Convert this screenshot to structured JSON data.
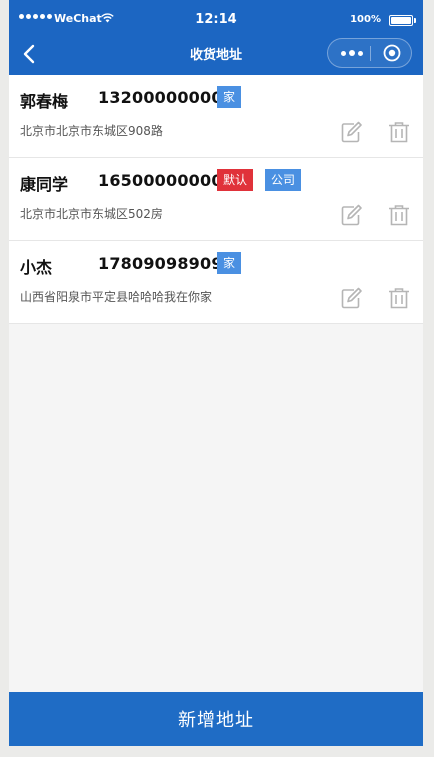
{
  "status_bar": {
    "carrier": "WeChat",
    "time": "12:14",
    "battery": "100%",
    "battery_level": 1.0,
    "signal_bars": 5
  },
  "nav": {
    "title": "收货地址",
    "back_icon": "chevron-left-icon",
    "more_icon": "more-dots-icon",
    "home_icon": "target-circle-icon"
  },
  "addresses": [
    {
      "name": "郭春梅",
      "phone": "13200000000",
      "tags": [
        {
          "label": "家",
          "kind": "home"
        }
      ],
      "address": "北京市北京市东城区908路"
    },
    {
      "name": "康同学",
      "phone": "16500000000",
      "tags": [
        {
          "label": "默认",
          "kind": "default"
        },
        {
          "label": "公司",
          "kind": "company"
        }
      ],
      "address": "北京市北京市东城区502房"
    },
    {
      "name": "小杰",
      "phone": "17809098909",
      "tags": [
        {
          "label": "家",
          "kind": "home"
        }
      ],
      "address": "山西省阳泉市平定县哈哈哈我在你家"
    }
  ],
  "actions": {
    "edit_icon": "edit-icon",
    "delete_icon": "trash-icon"
  },
  "footer": {
    "add_label": "新增地址"
  },
  "colors": {
    "primary": "#1c66c2",
    "tag_blue": "#4a90e2",
    "tag_red": "#e0323a",
    "background": "#f5f5f5"
  }
}
